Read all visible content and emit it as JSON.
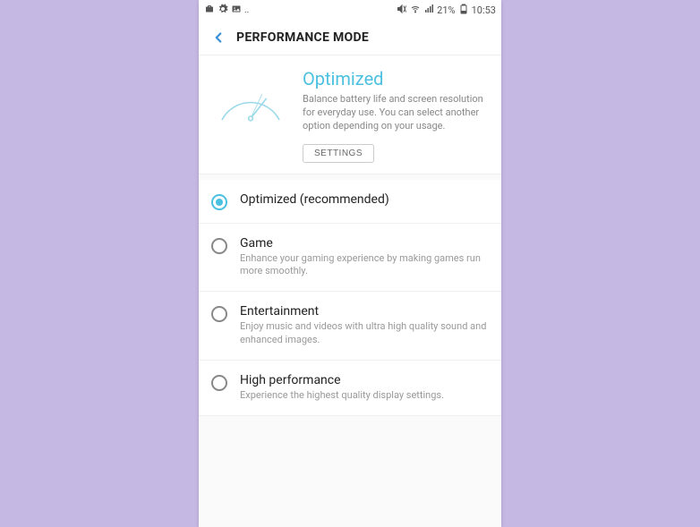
{
  "status": {
    "battery_pct": "21%",
    "time": "10:53"
  },
  "header": {
    "title": "PERFORMANCE MODE"
  },
  "hero": {
    "title": "Optimized",
    "description": "Balance battery life and screen resolution for everyday use. You can select another option depending on your usage.",
    "settings_label": "SETTINGS"
  },
  "options": [
    {
      "title": "Optimized (recommended)",
      "description": "",
      "selected": true
    },
    {
      "title": "Game",
      "description": "Enhance your gaming experience by making games run more smoothly.",
      "selected": false
    },
    {
      "title": "Entertainment",
      "description": "Enjoy music and videos with ultra high quality sound and enhanced images.",
      "selected": false
    },
    {
      "title": "High performance",
      "description": "Experience the highest quality display settings.",
      "selected": false
    }
  ]
}
